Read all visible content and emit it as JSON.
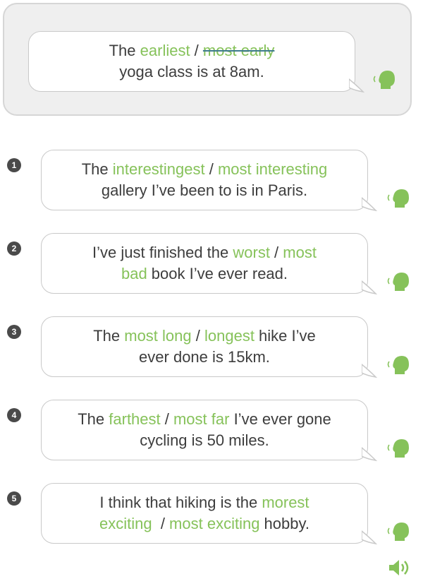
{
  "example": {
    "line1_a": "The ",
    "line1_opt1": "earliest",
    "line1_sep": " / ",
    "line1_opt2": "most early",
    "line2": "yoga class is at 8am."
  },
  "items": [
    {
      "number": "1",
      "line1_a": "The ",
      "opt1": "interestingest",
      "sep": " / ",
      "opt2": "most interesting",
      "line2": "gallery I’ve been to is in Paris."
    },
    {
      "number": "2",
      "line1_a": "I’ve just finished the ",
      "opt1": "worst",
      "sep": " / ",
      "opt2a": "most",
      "opt2b": "bad",
      "line2_rest": " book I’ve ever read."
    },
    {
      "number": "3",
      "line1_a": "The ",
      "opt1": "most long",
      "sep": " / ",
      "opt2": "longest",
      "line1_rest": " hike I’ve",
      "line2": "ever done is 15km."
    },
    {
      "number": "4",
      "line1_a": "The ",
      "opt1": "farthest",
      "sep": " / ",
      "opt2": "most far",
      "line1_rest": " I’ve ever gone",
      "line2": "cycling is 50 miles."
    },
    {
      "number": "5",
      "line1_a": "I think that hiking is the ",
      "opt1": "morest",
      "opt1b": "exciting",
      "sep": "  / ",
      "opt2": "most exciting",
      "line2_rest": " hobby."
    }
  ],
  "colors": {
    "accent": "#86c25a",
    "strike_line": "#3f7c8c",
    "text": "#3d3d3d"
  }
}
